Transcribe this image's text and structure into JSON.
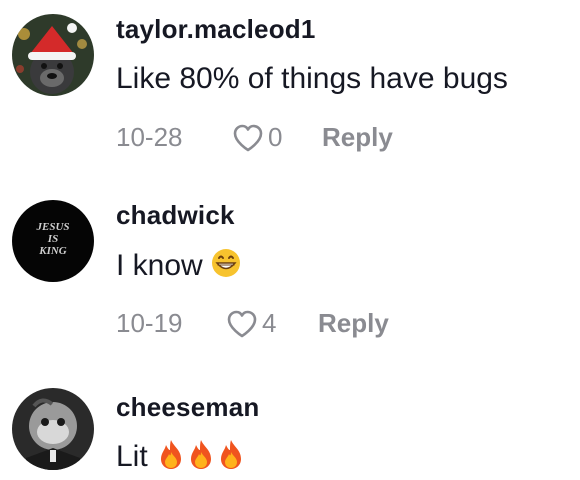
{
  "comments": [
    {
      "username": "taylor.macleod1",
      "text": "Like 80% of things have bugs",
      "date": "10-28",
      "likes": "0",
      "reply_label": "Reply"
    },
    {
      "username": "chadwick",
      "text": "I know",
      "date": "10-19",
      "likes": "4",
      "reply_label": "Reply",
      "avatar_text": [
        "JESUS",
        "IS",
        "KING"
      ]
    },
    {
      "username": "cheeseman",
      "text": "Lit",
      "emoji": [
        "fire-emoji",
        "fire-emoji",
        "fire-emoji"
      ]
    }
  ],
  "colors": {
    "username": "#161823",
    "text": "#161823",
    "meta": "#8a8b91",
    "background": "#ffffff"
  }
}
